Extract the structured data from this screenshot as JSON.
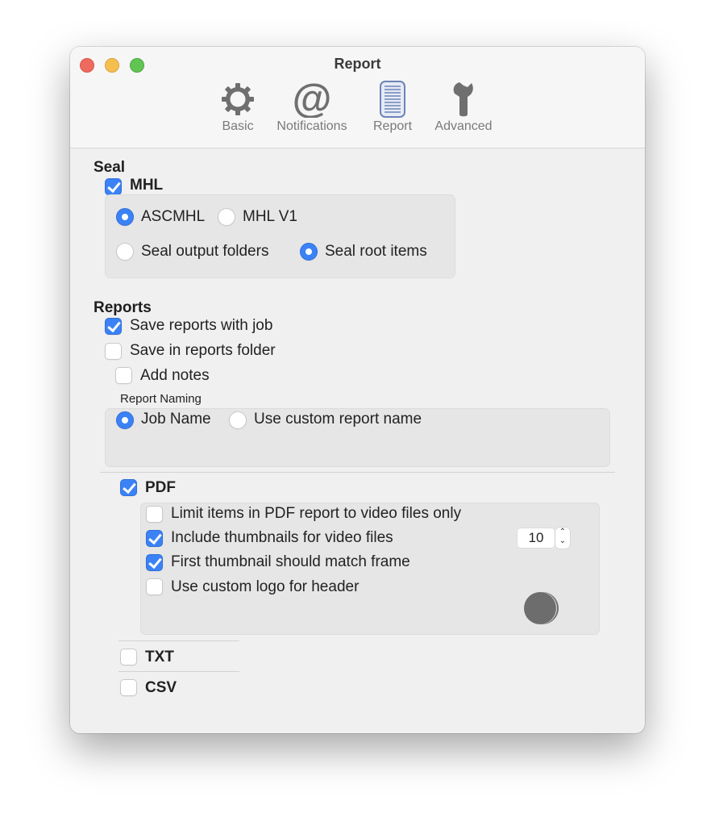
{
  "window": {
    "title": "Report"
  },
  "toolbar": {
    "items": [
      {
        "label": "Basic",
        "icon": "gear-icon",
        "selected": false
      },
      {
        "label": "Notifications",
        "icon": "at-sign-icon",
        "selected": false
      },
      {
        "label": "Report",
        "icon": "report-document-icon",
        "selected": true
      },
      {
        "label": "Advanced",
        "icon": "wrench-icon",
        "selected": false
      }
    ]
  },
  "seal": {
    "title": "Seal",
    "mhl": {
      "label": "MHL",
      "checked": true
    },
    "format_options": [
      {
        "label": "ASCMHL",
        "selected": true
      },
      {
        "label": "MHL V1",
        "selected": false
      }
    ],
    "scope_options": [
      {
        "label": "Seal output folders",
        "selected": false
      },
      {
        "label": "Seal root items",
        "selected": true
      }
    ]
  },
  "reports": {
    "title": "Reports",
    "save_with_job": {
      "label": "Save reports with job",
      "checked": true
    },
    "save_in_folder": {
      "label": "Save in reports folder",
      "checked": false
    },
    "add_notes": {
      "label": "Add notes",
      "checked": false
    },
    "naming": {
      "title": "Report Naming",
      "options": [
        {
          "label": "Job Name",
          "selected": true
        },
        {
          "label": "Use custom report name",
          "selected": false
        }
      ]
    },
    "pdf": {
      "label": "PDF",
      "checked": true,
      "limit_video": {
        "label": "Limit items in PDF report to video files only",
        "checked": false
      },
      "thumbnails": {
        "label": "Include thumbnails for video files",
        "checked": true,
        "count": "10"
      },
      "first_thumb": {
        "label": "First thumbnail should match frame",
        "checked": true
      },
      "custom_logo": {
        "label": "Use custom logo for header",
        "checked": false
      }
    },
    "txt": {
      "label": "TXT",
      "checked": false
    },
    "csv": {
      "label": "CSV",
      "checked": false
    }
  },
  "colors": {
    "accent": "#3b82f6",
    "close": "#ee6a5e",
    "minimize": "#f5bf4f",
    "maximize": "#61c554"
  }
}
